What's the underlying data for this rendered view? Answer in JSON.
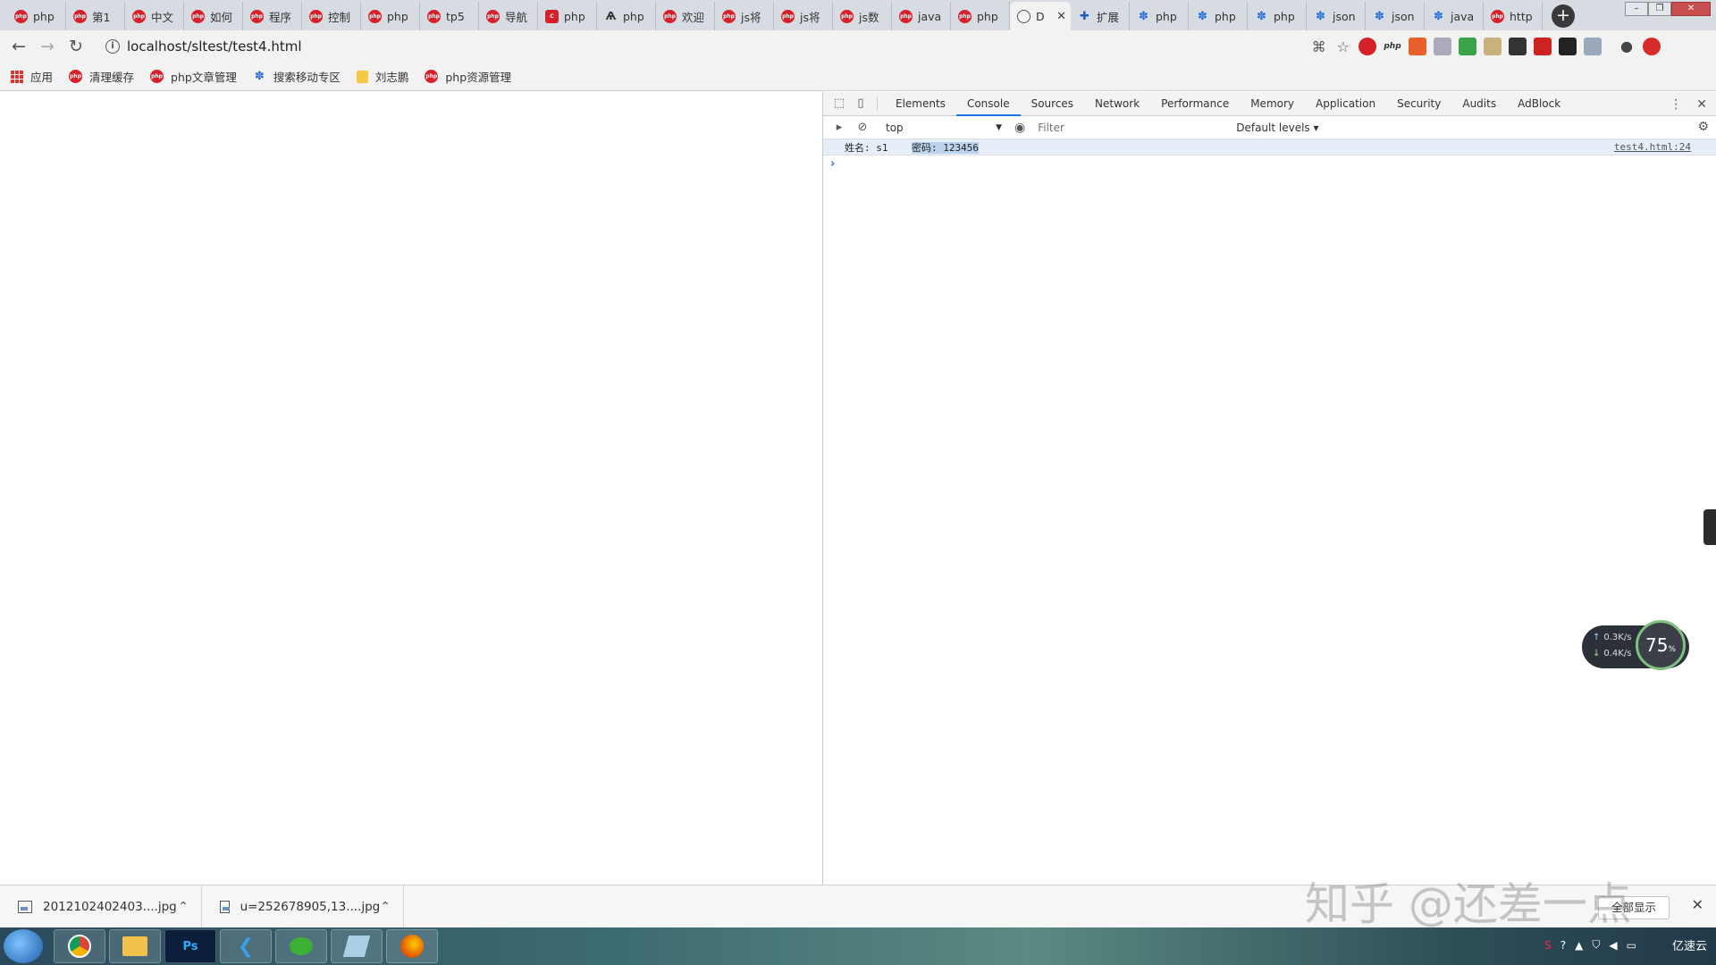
{
  "tabs": [
    {
      "label": "php",
      "icon": "php-icon"
    },
    {
      "label": "第1",
      "icon": "php-icon"
    },
    {
      "label": "中文",
      "icon": "php-icon"
    },
    {
      "label": "如何",
      "icon": "php-icon"
    },
    {
      "label": "程序",
      "icon": "php-icon"
    },
    {
      "label": "控制",
      "icon": "php-icon"
    },
    {
      "label": "php",
      "icon": "php-icon"
    },
    {
      "label": "tp5",
      "icon": "php-icon"
    },
    {
      "label": "导航",
      "icon": "php-icon"
    },
    {
      "label": "php",
      "icon": "c-logo-icon"
    },
    {
      "label": "php",
      "icon": "dark-logo-icon"
    },
    {
      "label": "欢迎",
      "icon": "php-icon"
    },
    {
      "label": "js将",
      "icon": "php-icon"
    },
    {
      "label": "js将",
      "icon": "php-icon"
    },
    {
      "label": "js数",
      "icon": "php-icon"
    },
    {
      "label": "java",
      "icon": "php-icon"
    },
    {
      "label": "php",
      "icon": "php-icon"
    },
    {
      "label": "D",
      "icon": "globe-icon",
      "active": true
    },
    {
      "label": "扩展",
      "icon": "puzzle-icon"
    },
    {
      "label": "php",
      "icon": "paw-icon"
    },
    {
      "label": "php",
      "icon": "paw-icon"
    },
    {
      "label": "php",
      "icon": "paw-icon"
    },
    {
      "label": "json",
      "icon": "paw-icon"
    },
    {
      "label": "json",
      "icon": "paw-icon"
    },
    {
      "label": "java",
      "icon": "paw-icon"
    },
    {
      "label": "http",
      "icon": "php-icon"
    }
  ],
  "address_bar": {
    "url": "localhost/sltest/test4.html"
  },
  "bookmarks": [
    {
      "label": "应用",
      "icon": "apps-grid-icon"
    },
    {
      "label": "清理缓存",
      "icon": "php-icon"
    },
    {
      "label": "php文章管理",
      "icon": "php-icon"
    },
    {
      "label": "搜索移动专区",
      "icon": "paw-icon"
    },
    {
      "label": "刘志鹏",
      "icon": "folder-icon"
    },
    {
      "label": "php资源管理",
      "icon": "php-icon"
    }
  ],
  "devtools": {
    "tabs": [
      "Elements",
      "Console",
      "Sources",
      "Network",
      "Performance",
      "Memory",
      "Application",
      "Security",
      "Audits",
      "AdBlock"
    ],
    "active_tab": "Console",
    "context": "top",
    "filter_placeholder": "Filter",
    "levels": "Default levels ▾",
    "messages": [
      {
        "name_part": "姓名: s1",
        "selected_part": "密码: 123456",
        "source": "test4.html:24"
      }
    ]
  },
  "net_widget": {
    "up": "0.3K/s",
    "down": "0.4K/s",
    "percent": "75",
    "percent_unit": "%"
  },
  "downloads": [
    {
      "file": "2012102402403....jpg"
    },
    {
      "file": "u=252678905,13....jpg"
    }
  ],
  "show_all_label": "全部显示",
  "watermark": "知乎 @还差一点",
  "taskbar": {
    "apps": [
      "chrome",
      "explorer",
      "Ps",
      "vscode",
      "wechat",
      "notepad",
      "firefox"
    ],
    "tray_logo": "亿速云"
  },
  "colors": {
    "accent": "#1a73e8",
    "php_red": "#d6212a"
  }
}
